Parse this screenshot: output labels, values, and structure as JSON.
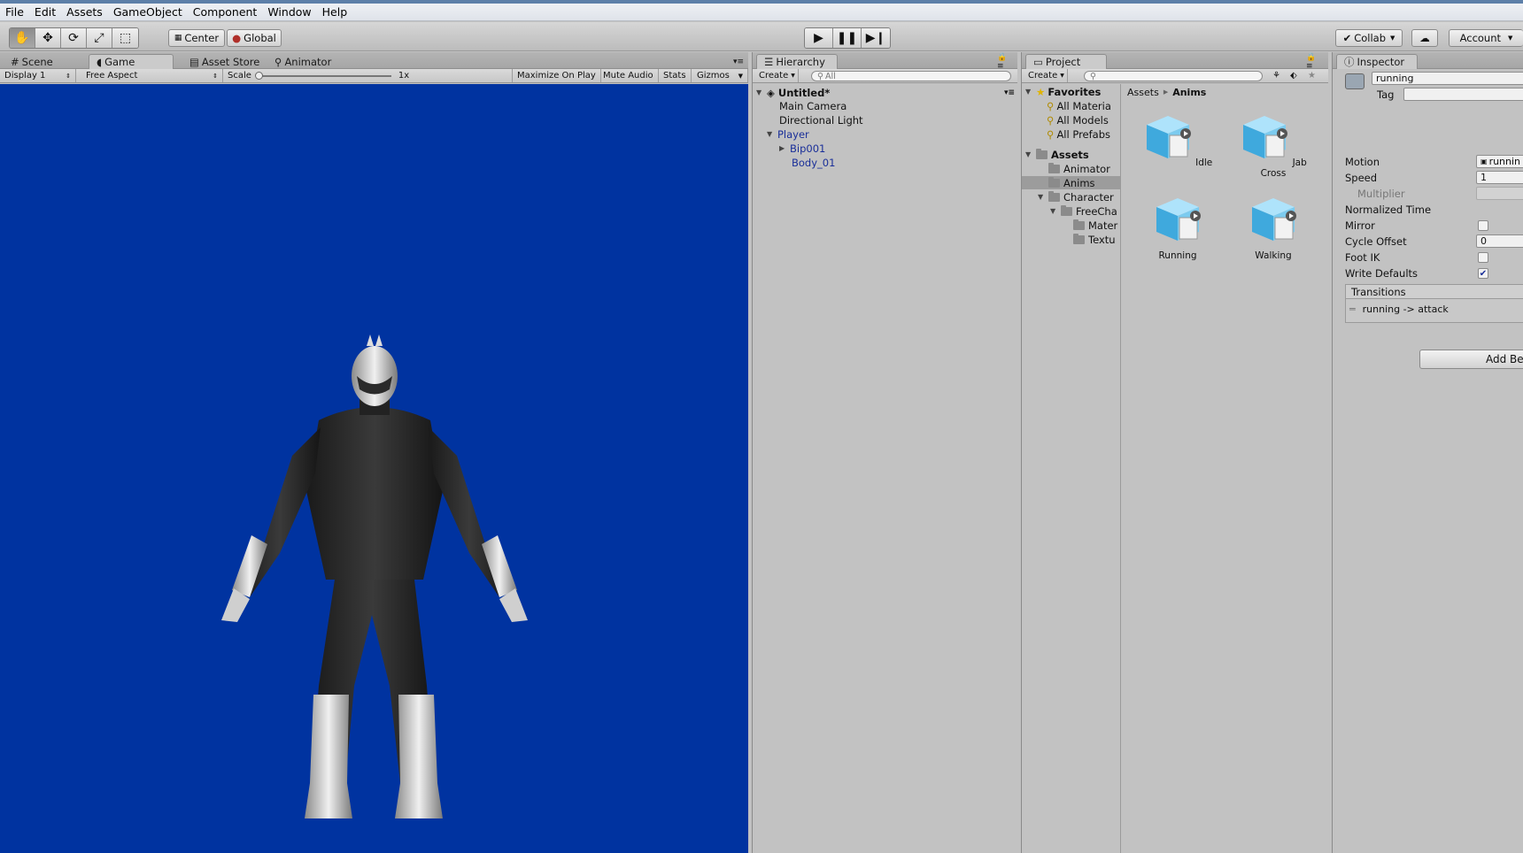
{
  "menu": [
    "File",
    "Edit",
    "Assets",
    "GameObject",
    "Component",
    "Window",
    "Help"
  ],
  "toolbar": {
    "pivot_label": "Center",
    "space_label": "Global",
    "collab_label": "Collab",
    "account_label": "Account"
  },
  "game_panel": {
    "tabs": [
      "Scene",
      "Game",
      "Asset Store",
      "Animator"
    ],
    "active_tab": "Game",
    "display": "Display 1",
    "aspect": "Free Aspect",
    "scale_label": "Scale",
    "scale_value": "1x",
    "maximize": "Maximize On Play",
    "mute": "Mute Audio",
    "stats": "Stats",
    "gizmos": "Gizmos",
    "background_color": "#0033a0"
  },
  "hierarchy": {
    "tab": "Hierarchy",
    "create": "Create",
    "search_placeholder": "All",
    "scene": "Untitled*",
    "items": [
      "Main Camera",
      "Directional Light",
      "Player",
      "Bip001",
      "Body_01"
    ]
  },
  "project": {
    "tab": "Project",
    "create": "Create",
    "favorites_label": "Favorites",
    "favorites": [
      "All Materia",
      "All Models",
      "All Prefabs"
    ],
    "assets_label": "Assets",
    "folders": [
      "Animator",
      "Anims",
      "Character",
      "FreeCha",
      "Mater",
      "Textu"
    ],
    "breadcrumb": [
      "Assets",
      "Anims"
    ],
    "assets": [
      "Idle",
      "Jab Cross",
      "Running",
      "Walking"
    ]
  },
  "inspector": {
    "tab": "Inspector",
    "name": "running",
    "tag_label": "Tag",
    "fields": {
      "motion_label": "Motion",
      "motion_value": "runnin",
      "speed_label": "Speed",
      "speed_value": "1",
      "multiplier_label": "Multiplier",
      "normalized_label": "Normalized Time",
      "mirror_label": "Mirror",
      "cycle_label": "Cycle Offset",
      "cycle_value": "0",
      "footik_label": "Foot IK",
      "write_label": "Write Defaults"
    },
    "transitions_label": "Transitions",
    "transition": "running -> attack",
    "add_button": "Add Bel"
  }
}
